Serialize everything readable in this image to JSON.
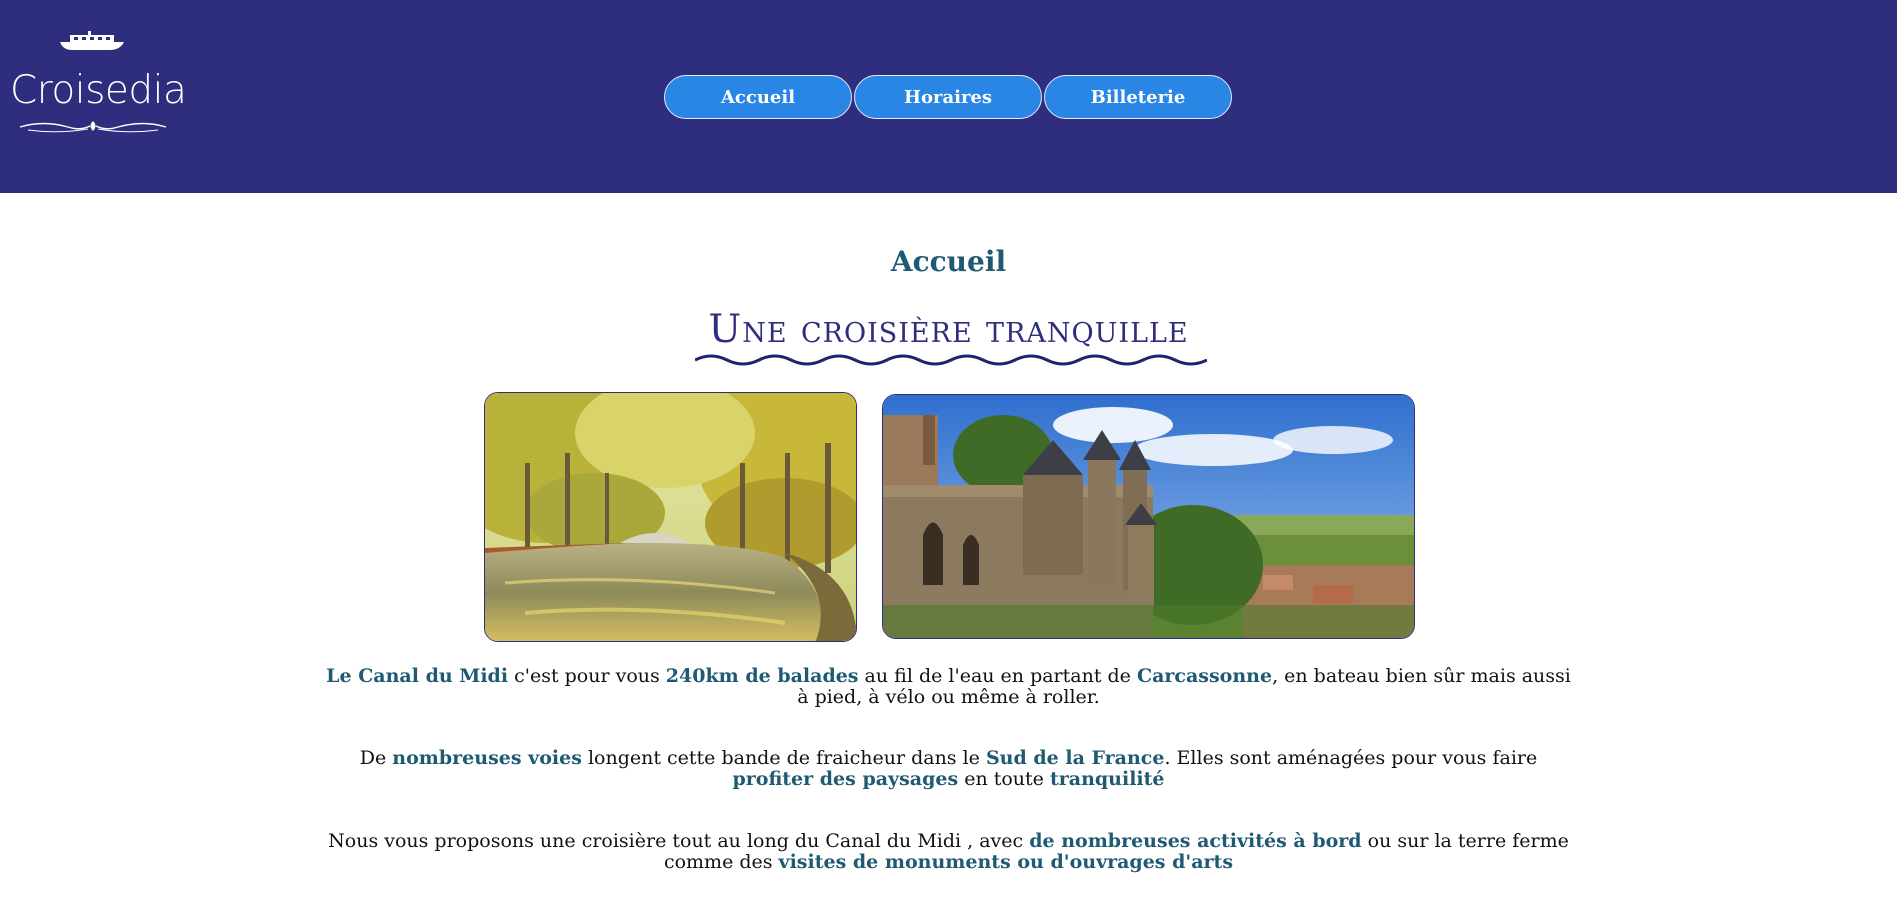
{
  "brand": {
    "name": "Croisedia",
    "boat_icon": "boat-icon",
    "flourish_icon": "flourish-ornament"
  },
  "nav": {
    "items": [
      {
        "label": "Accueil"
      },
      {
        "label": "Horaires"
      },
      {
        "label": "Billeterie"
      }
    ]
  },
  "main": {
    "heading": "Accueil",
    "title": "Une croisière tranquille",
    "paragraphs": [
      {
        "segments": [
          {
            "text": "Le Canal du Midi",
            "highlight": true
          },
          {
            "text": " c'est pour vous ",
            "highlight": false
          },
          {
            "text": "240km de balades",
            "highlight": true
          },
          {
            "text": " au fil de l'eau en partant de ",
            "highlight": false
          },
          {
            "text": "Carcassonne",
            "highlight": true
          },
          {
            "text": ", en bateau bien sûr mais aussi à pied, à vélo ou même à roller.",
            "highlight": false
          }
        ]
      },
      {
        "segments": [
          {
            "text": "De ",
            "highlight": false
          },
          {
            "text": "nombreuses voies",
            "highlight": true
          },
          {
            "text": " longent cette bande de fraicheur dans le ",
            "highlight": false
          },
          {
            "text": "Sud de la France",
            "highlight": true
          },
          {
            "text": ". Elles sont aménagées pour vous faire ",
            "highlight": false
          },
          {
            "text": "profiter des paysages",
            "highlight": true
          },
          {
            "text": " en toute ",
            "highlight": false
          },
          {
            "text": "tranquilité",
            "highlight": true
          }
        ]
      },
      {
        "segments": [
          {
            "text": "Nous vous proposons une croisière tout au long du Canal du Midi , avec ",
            "highlight": false
          },
          {
            "text": "de nombreuses activités à bord",
            "highlight": true
          },
          {
            "text": " ou sur la terre ferme comme des ",
            "highlight": false
          },
          {
            "text": "visites de monuments ou d'ouvrages d'arts",
            "highlight": true
          }
        ]
      }
    ]
  },
  "colors": {
    "header_bg": "#2e2d7e",
    "nav_button": "#2a86e4",
    "highlight_text": "#1f5a73",
    "title_text": "#2e2d7e"
  }
}
